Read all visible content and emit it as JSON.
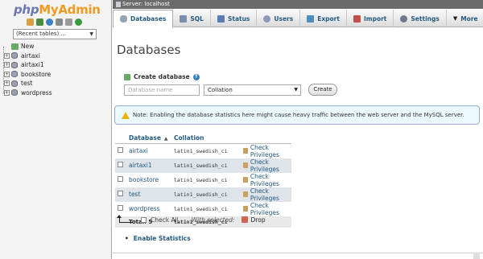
{
  "nav": {
    "logo": {
      "php": "php",
      "my": "My",
      "admin": "Admin"
    },
    "recent_tables": "(Recent tables) ...",
    "tree": [
      {
        "label": "New",
        "type": "new"
      },
      {
        "label": "airtaxi",
        "type": "db"
      },
      {
        "label": "airtaxi1",
        "type": "db"
      },
      {
        "label": "bookstore",
        "type": "db"
      },
      {
        "label": "test",
        "type": "db"
      },
      {
        "label": "wordpress",
        "type": "db"
      }
    ]
  },
  "topbar": {
    "server": "Server: localhost"
  },
  "tabs": [
    {
      "label": "Databases",
      "icon": "database-icon",
      "active": true
    },
    {
      "label": "SQL",
      "icon": "sql-icon"
    },
    {
      "label": "Status",
      "icon": "status-icon"
    },
    {
      "label": "Users",
      "icon": "users-icon"
    },
    {
      "label": "Export",
      "icon": "export-icon"
    },
    {
      "label": "Import",
      "icon": "import-icon"
    },
    {
      "label": "Settings",
      "icon": "settings-icon"
    },
    {
      "label": "More",
      "icon": "more-dropdown-icon"
    }
  ],
  "page": {
    "title": "Databases"
  },
  "create": {
    "label": "Create database",
    "name_placeholder": "Database name",
    "collation_value": "Collation",
    "button": "Create"
  },
  "notice": "Note: Enabling the database statistics here might cause heavy traffic between the web server and the MySQL server.",
  "table": {
    "headers": {
      "database": "Database",
      "collation": "Collation"
    },
    "rows": [
      {
        "name": "airtaxi",
        "collation": "latin1_swedish_ci",
        "action": "Check Privileges"
      },
      {
        "name": "airtaxi1",
        "collation": "latin1_swedish_ci",
        "action": "Check Privileges"
      },
      {
        "name": "bookstore",
        "collation": "latin1_swedish_ci",
        "action": "Check Privileges"
      },
      {
        "name": "test",
        "collation": "latin1_swedish_ci",
        "action": "Check Privileges"
      },
      {
        "name": "wordpress",
        "collation": "latin1_swedish_ci",
        "action": "Check Privileges"
      }
    ],
    "total_label": "Total: 5",
    "total_collation": "latin1_swedish_ci"
  },
  "bulk": {
    "check_all": "Check All",
    "with_selected": "With selected:",
    "drop": "Drop"
  },
  "enable_stats": "Enable Statistics",
  "colors": {
    "link": "#235a81",
    "row_alt": "#dfe3ea",
    "notice_bg": "#ebf8fd",
    "logo_orange": "#f29a1f",
    "logo_blue": "#6c78af"
  }
}
